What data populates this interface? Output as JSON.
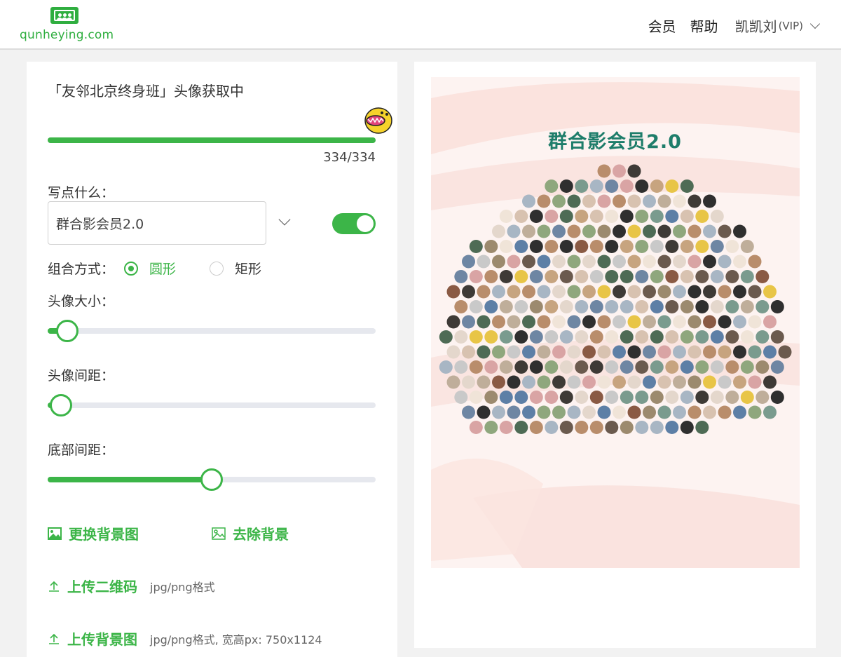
{
  "header": {
    "logo_text": "qunheying.com",
    "nav": [
      {
        "label": "会员"
      },
      {
        "label": "帮助"
      }
    ],
    "user": {
      "name": "凯凯刘",
      "tag": "(VIP)"
    }
  },
  "panel": {
    "title": "「友邻北京终身班」头像获取中",
    "progress": {
      "current": 334,
      "total": 334,
      "label": "334/334"
    },
    "write_label": "写点什么：",
    "text_value": "群合影会员2.0",
    "toggle_on": true,
    "layout_label": "组合方式：",
    "layout_options": [
      {
        "label": "圆形",
        "checked": true
      },
      {
        "label": "矩形",
        "checked": false
      }
    ],
    "sliders": [
      {
        "label": "头像大小：",
        "value": 0.06
      },
      {
        "label": "头像间距：",
        "value": 0.04
      },
      {
        "label": "底部间距：",
        "value": 0.5
      }
    ],
    "actions": {
      "change_bg": "更换背景图",
      "remove_bg": "去除背景",
      "upload_qr": "上传二维码",
      "upload_qr_hint": "jpg/png格式",
      "upload_bg": "上传背景图",
      "upload_bg_hint": "jpg/png格式, 宽高px: 750x1124"
    },
    "colors": {
      "accent": "#3cb548"
    }
  },
  "preview": {
    "title": "群合影会员2.0",
    "avatar_count": 334,
    "shape": "circle"
  }
}
